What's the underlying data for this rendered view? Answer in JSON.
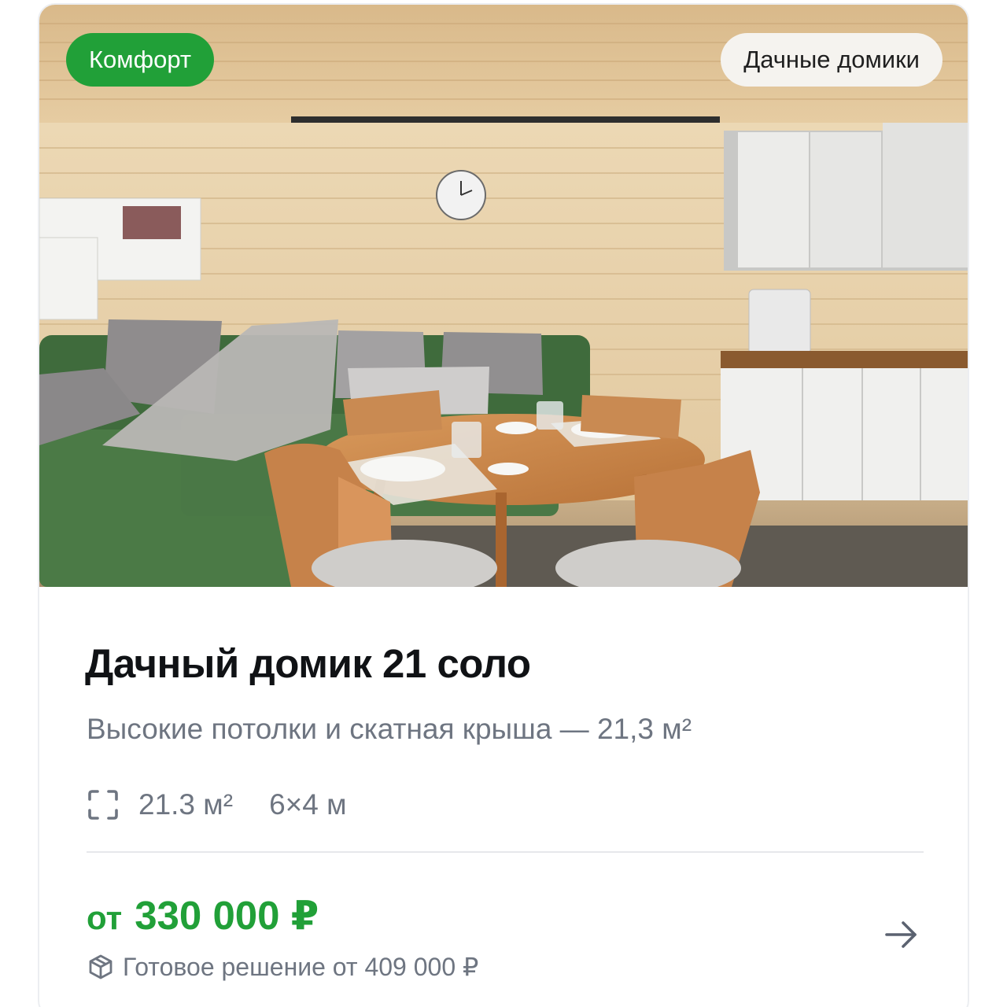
{
  "card": {
    "badge_class": "Комфорт",
    "badge_category": "Дачные домики",
    "title": "Дачный домик 21 соло",
    "subtitle": "Высокие потолки и скатная крыша — 21,3 м²",
    "specs": {
      "area_icon": "area-frame-icon",
      "area": "21.3 м²",
      "dimensions": "6×4 м"
    },
    "price": {
      "prefix": "от",
      "value": "330 000 ₽"
    },
    "ready_solution": {
      "icon": "box-icon",
      "text": "Готовое решение от 409 000 ₽"
    },
    "action_icon": "arrow-right-icon"
  },
  "colors": {
    "accent_green": "#21a038",
    "title": "#101215",
    "muted_text": "#6e7581",
    "divider": "#e6e8eb",
    "badge_light_bg": "#f5f3ef"
  }
}
